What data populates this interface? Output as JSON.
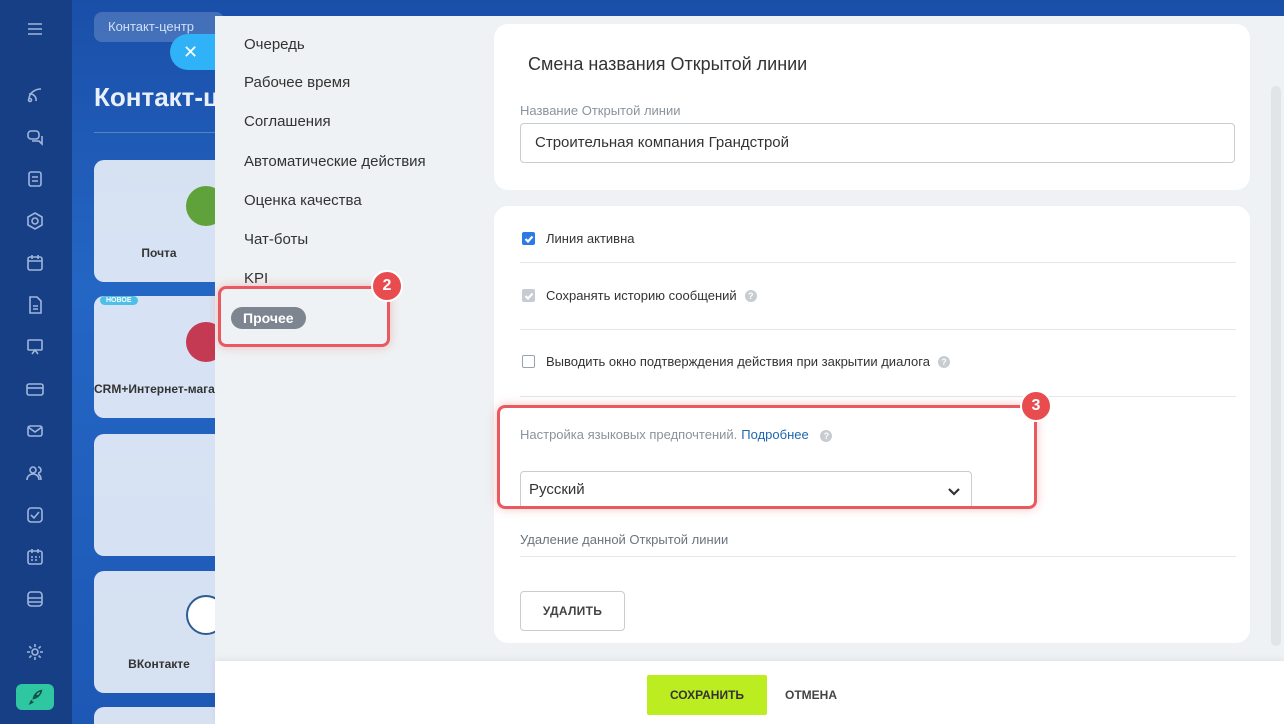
{
  "background": {
    "breadcrumb": "Контакт-центр",
    "page_title": "Контакт-центр",
    "cards": [
      {
        "label": "Почта"
      },
      {
        "badge": "НОВОЕ",
        "label": "CRM+Интернет-магазин"
      },
      {
        "label": ""
      },
      {
        "label": "ВКонтакте"
      }
    ],
    "rail_icons": [
      "menu-icon",
      "feed-icon",
      "chat-icon",
      "tasks-icon",
      "sites-icon",
      "calendar-icon",
      "docs-icon",
      "board-icon",
      "card-icon",
      "mail-icon",
      "users-icon",
      "check-icon",
      "planner-icon",
      "storage-icon",
      "settings-icon",
      "rocket-icon"
    ]
  },
  "slider": {
    "close_icon": "✕",
    "menu": [
      {
        "label": "Очередь"
      },
      {
        "label": "Рабочее время"
      },
      {
        "label": "Соглашения"
      },
      {
        "label": "Автоматические действия"
      },
      {
        "label": "Оценка качества"
      },
      {
        "label": "Чат-боты"
      },
      {
        "label": "KPI"
      },
      {
        "label": "Прочее",
        "active": true
      }
    ],
    "rename": {
      "title": "Смена названия Открытой линии",
      "field_label": "Название Открытой линии",
      "field_value": "Строительная компания Грандстрой"
    },
    "options": {
      "line_active": {
        "label": "Линия активна",
        "checked": true
      },
      "save_history": {
        "label": "Сохранять историю сообщений",
        "checked": true,
        "disabled": true
      },
      "confirm_close": {
        "label": "Выводить окно подтверждения действия при закрытии диалога",
        "checked": false
      },
      "language": {
        "label": "Настройка языковых предпочтений.",
        "link": "Подробнее",
        "value": "Русский"
      },
      "delete": {
        "label": "Удаление данной Открытой линии",
        "button": "УДАЛИТЬ"
      }
    },
    "footer": {
      "save": "СОХРАНИТЬ",
      "cancel": "ОТМЕНА"
    }
  },
  "annotations": [
    {
      "number": "2"
    },
    {
      "number": "3"
    }
  ],
  "colors": {
    "accent": "#2fb2f7",
    "save": "#bbed21",
    "highlight": "#e85a5f",
    "checkbox": "#2a7be4"
  }
}
